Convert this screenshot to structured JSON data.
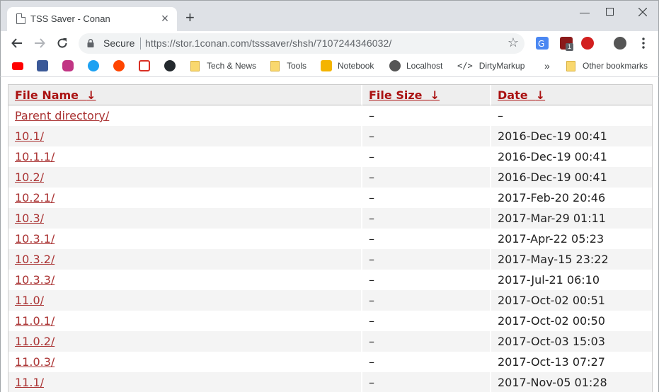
{
  "tab": {
    "title": "TSS Saver - Conan"
  },
  "omnibox": {
    "secure_label": "Secure",
    "url": "https://stor.1conan.com/tsssaver/shsh/7107244346032/"
  },
  "bookmarks": [
    {
      "label": "Tech & News",
      "icon": "folder-icon"
    },
    {
      "label": "Tools",
      "icon": "folder-icon"
    },
    {
      "label": "Notebook",
      "icon": "notebook-icon"
    },
    {
      "label": "Localhost",
      "icon": "localhost-icon"
    },
    {
      "label": "DirtyMarkup",
      "icon": "code-icon"
    }
  ],
  "other_bookmarks": "Other bookmarks",
  "ext_badge": "1",
  "table": {
    "headers": {
      "name": "File Name",
      "size": "File Size",
      "date": "Date",
      "sort_glyph": "↓"
    },
    "rows": [
      {
        "name": "Parent directory/",
        "size": "–",
        "date": "–"
      },
      {
        "name": "10.1/",
        "size": "–",
        "date": "2016-Dec-19 00:41"
      },
      {
        "name": "10.1.1/",
        "size": "–",
        "date": "2016-Dec-19 00:41"
      },
      {
        "name": "10.2/",
        "size": "–",
        "date": "2016-Dec-19 00:41"
      },
      {
        "name": "10.2.1/",
        "size": "–",
        "date": "2017-Feb-20 20:46"
      },
      {
        "name": "10.3/",
        "size": "–",
        "date": "2017-Mar-29 01:11"
      },
      {
        "name": "10.3.1/",
        "size": "–",
        "date": "2017-Apr-22 05:23"
      },
      {
        "name": "10.3.2/",
        "size": "–",
        "date": "2017-May-15 23:22"
      },
      {
        "name": "10.3.3/",
        "size": "–",
        "date": "2017-Jul-21 06:10"
      },
      {
        "name": "11.0/",
        "size": "–",
        "date": "2017-Oct-02 00:51"
      },
      {
        "name": "11.0.1/",
        "size": "–",
        "date": "2017-Oct-02 00:50"
      },
      {
        "name": "11.0.2/",
        "size": "–",
        "date": "2017-Oct-03 15:03"
      },
      {
        "name": "11.0.3/",
        "size": "–",
        "date": "2017-Oct-13 07:27"
      },
      {
        "name": "11.1/",
        "size": "–",
        "date": "2017-Nov-05 01:28"
      }
    ]
  }
}
